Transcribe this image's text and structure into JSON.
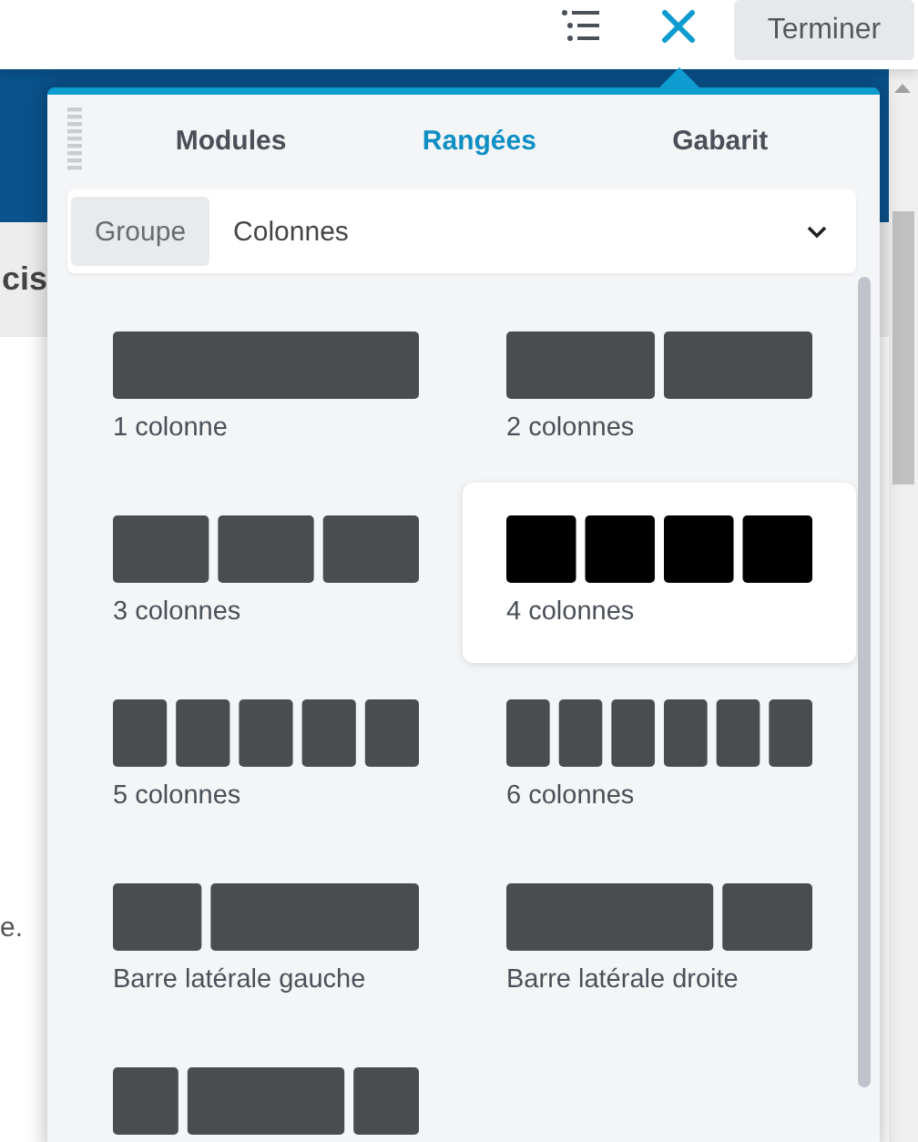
{
  "toolbar": {
    "done_button": "Terminer"
  },
  "background_page": {
    "heading_fragment": "cis",
    "text_fragment": "e."
  },
  "panel": {
    "tabs": [
      {
        "label": "Modules",
        "selected": false
      },
      {
        "label": "Rangées",
        "selected": true
      },
      {
        "label": "Gabarit",
        "selected": false
      }
    ],
    "group_filter": {
      "label": "Groupe",
      "value": "Colonnes"
    },
    "layouts": [
      {
        "label": "1 colonne",
        "kind": "one",
        "selected": false
      },
      {
        "label": "2 colonnes",
        "kind": "two",
        "selected": false
      },
      {
        "label": "3 colonnes",
        "kind": "three",
        "selected": false
      },
      {
        "label": "4 colonnes",
        "kind": "four",
        "selected": true
      },
      {
        "label": "5 colonnes",
        "kind": "five",
        "selected": false
      },
      {
        "label": "6 colonnes",
        "kind": "six",
        "selected": false
      },
      {
        "label": "Barre latérale gauche",
        "kind": "left-sidebar",
        "selected": false
      },
      {
        "label": "Barre latérale droite",
        "kind": "right-sidebar",
        "selected": false
      },
      {
        "kind": "both-sidebars",
        "selected": false
      }
    ]
  }
}
